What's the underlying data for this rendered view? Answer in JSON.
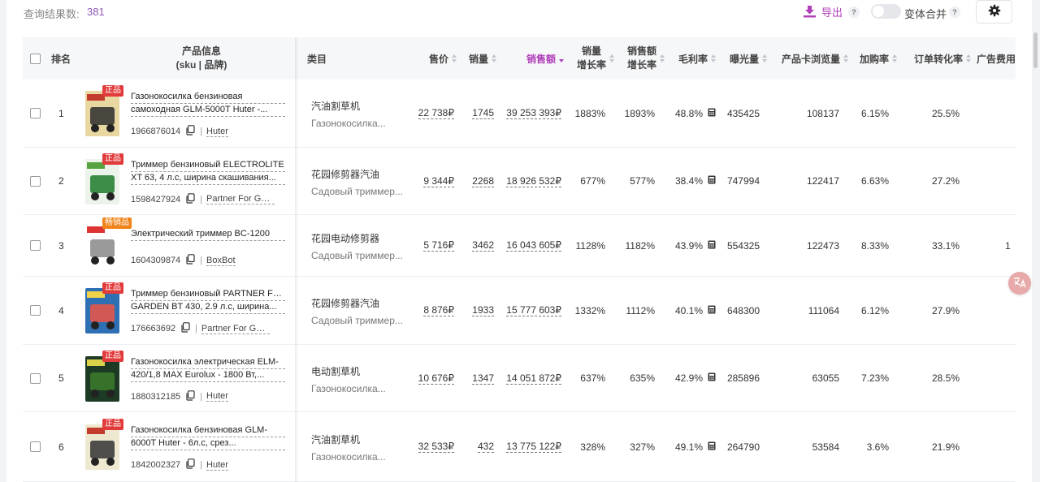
{
  "topbar": {
    "result_label": "查询结果数:",
    "result_count": "381",
    "export_label": "导出",
    "help_mark": "?",
    "merge_label": "变体合并"
  },
  "columns": {
    "rank": "排名",
    "product_line1": "产品信息",
    "product_line2": "(sku | 品牌)",
    "category": "类目",
    "price": "售价",
    "sales": "销量",
    "revenue": "销售额",
    "sales_growth_1": "销量",
    "sales_growth_2": "增长率",
    "rev_growth_1": "销售额",
    "rev_growth_2": "增长率",
    "margin": "毛利率",
    "impressions": "曝光量",
    "card_views": "产品卡浏览量",
    "cart_rate": "加购率",
    "order_rate": "订单转化率",
    "ad_cost": "广告费用"
  },
  "colors": {
    "accent": "#b03fb9",
    "badge_red": "#e23b3b",
    "badge_orange": "#f08319"
  },
  "rows": [
    {
      "rank": "1",
      "badge": "正品",
      "badge_color": "red",
      "name_line1": "Газонокосилка бензиновая",
      "name_line2": "самоходная GLM-5000T Huter -...",
      "sku": "1966876014",
      "sep": "|",
      "brand": "Huter",
      "cat1": "汽油割草机",
      "cat2": "Газонокосилка...",
      "price": "22 738₽",
      "sales": "1745",
      "revenue": "39 253 393₽",
      "sales_growth": "1883%",
      "rev_growth": "1893%",
      "margin": "48.8%",
      "impressions": "435425",
      "card_views": "108137",
      "cart_rate": "6.15%",
      "order_rate": "25.5%",
      "ad_cost": ""
    },
    {
      "rank": "2",
      "badge": "正品",
      "badge_color": "red",
      "name_line1": "Триммер бензиновый ELECTROLITE",
      "name_line2": "XT 63, 4 л.с, ширина скашивания...",
      "sku": "1598427924",
      "sep": "|",
      "brand": "Partner For Gar...",
      "cat1": "花园修剪器汽油",
      "cat2": "Садовый триммер...",
      "price": "9 344₽",
      "sales": "2268",
      "revenue": "18 926 532₽",
      "sales_growth": "677%",
      "rev_growth": "577%",
      "margin": "38.4%",
      "impressions": "747994",
      "card_views": "122417",
      "cart_rate": "6.63%",
      "order_rate": "27.2%",
      "ad_cost": ""
    },
    {
      "rank": "3",
      "badge": "畅销品",
      "badge_color": "orange",
      "name_line1": "Электрический триммер BC-1200",
      "name_line2": "",
      "sku": "1604309874",
      "sep": "|",
      "brand": "BoxBot",
      "cat1": "花园电动修剪器",
      "cat2": "Садовый триммер...",
      "price": "5 716₽",
      "sales": "3462",
      "revenue": "16 043 605₽",
      "sales_growth": "1128%",
      "rev_growth": "1182%",
      "margin": "43.9%",
      "impressions": "554325",
      "card_views": "122473",
      "cart_rate": "8.33%",
      "order_rate": "33.1%",
      "ad_cost": "1"
    },
    {
      "rank": "4",
      "badge": "正品",
      "badge_color": "red",
      "name_line1": "Триммер бензиновый PARTNER FOR",
      "name_line2": "GARDEN BT 430, 2.9 л.с, ширина...",
      "sku": "176663692",
      "sep": "|",
      "brand": "Partner For Gar...",
      "cat1": "花园修剪器汽油",
      "cat2": "Садовый триммер...",
      "price": "8 876₽",
      "sales": "1933",
      "revenue": "15 777 603₽",
      "sales_growth": "1332%",
      "rev_growth": "1112%",
      "margin": "40.1%",
      "impressions": "648300",
      "card_views": "111064",
      "cart_rate": "6.12%",
      "order_rate": "27.9%",
      "ad_cost": ""
    },
    {
      "rank": "5",
      "badge": "正品",
      "badge_color": "red",
      "name_line1": "Газонокосилка электрическая ELM-",
      "name_line2": "420/1,8 MAX Eurolux - 1800 Вт,...",
      "sku": "1880312185",
      "sep": "|",
      "brand": "Huter",
      "cat1": "电动割草机",
      "cat2": "Газонокосилка...",
      "price": "10 676₽",
      "sales": "1347",
      "revenue": "14 051 872₽",
      "sales_growth": "637%",
      "rev_growth": "635%",
      "margin": "42.9%",
      "impressions": "285896",
      "card_views": "63055",
      "cart_rate": "7.23%",
      "order_rate": "28.5%",
      "ad_cost": ""
    },
    {
      "rank": "6",
      "badge": "正品",
      "badge_color": "red",
      "name_line1": "Газонокосилка бензиновая GLM-",
      "name_line2": "6000T Huter - 6л.с, срез...",
      "sku": "1842002327",
      "sep": "|",
      "brand": "Huter",
      "cat1": "汽油割草机",
      "cat2": "Газонокосилка...",
      "price": "32 533₽",
      "sales": "432",
      "revenue": "13 775 122₽",
      "sales_growth": "328%",
      "rev_growth": "327%",
      "margin": "49.1%",
      "impressions": "264790",
      "card_views": "53584",
      "cart_rate": "3.6%",
      "order_rate": "21.9%",
      "ad_cost": ""
    }
  ]
}
